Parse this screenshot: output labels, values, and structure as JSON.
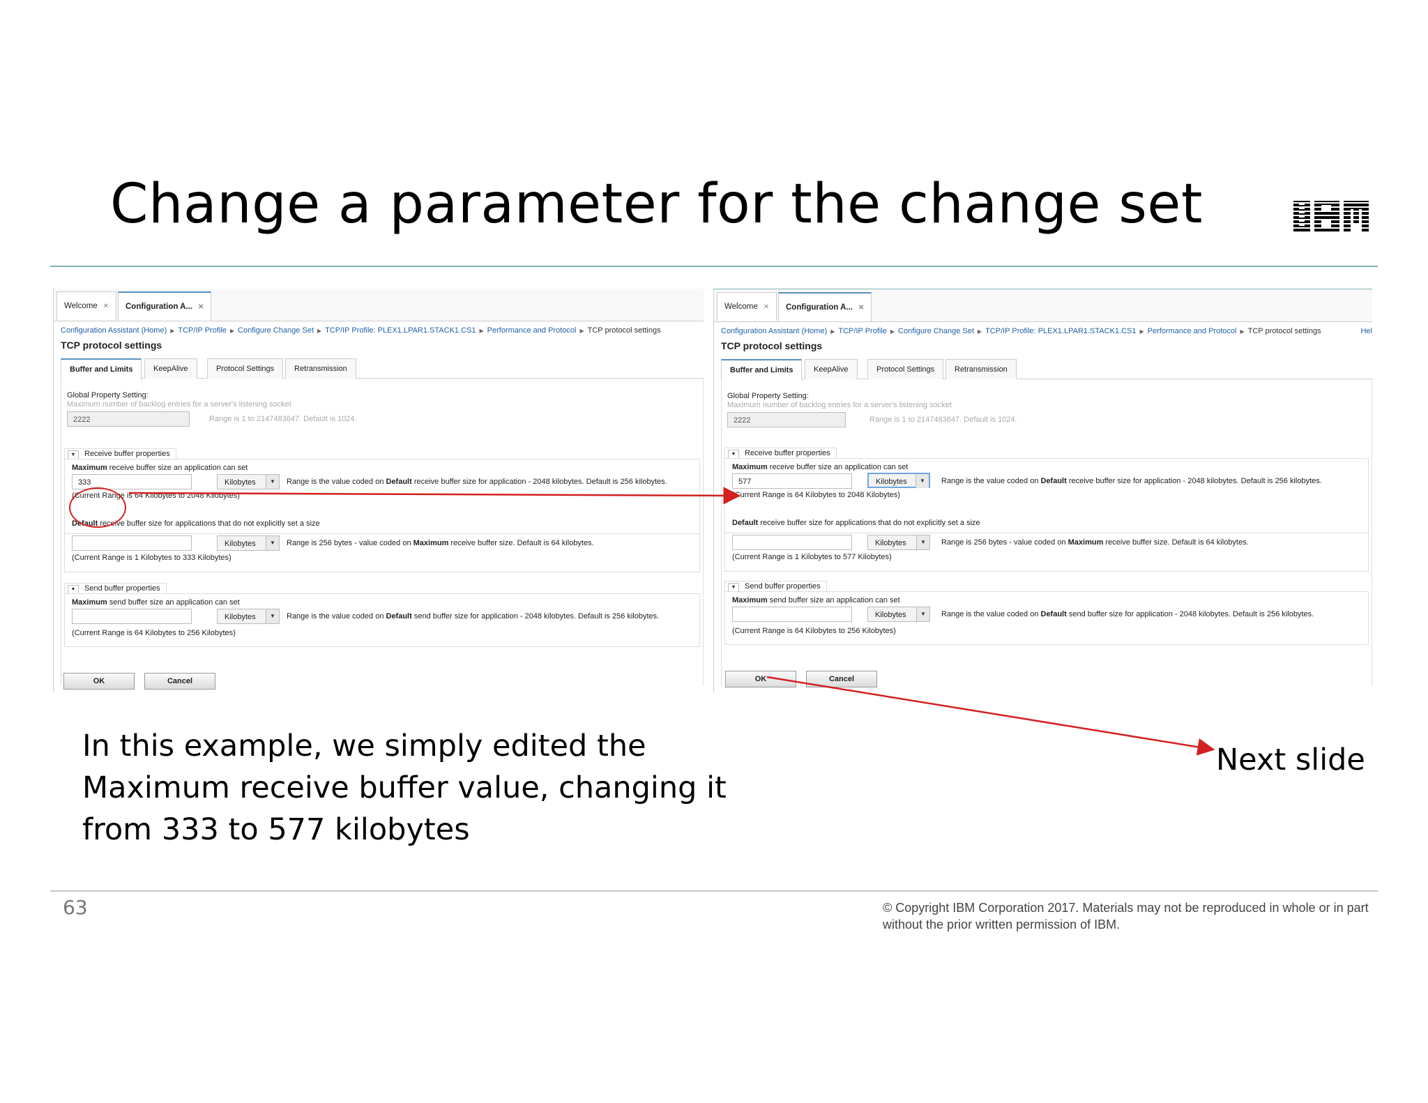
{
  "slide": {
    "title": "Change a parameter for the change set",
    "caption": "In this example, we simply edited the Maximum receive buffer value, changing it from 333 to 577 kilobytes",
    "next_label": "Next slide",
    "slide_number": "63",
    "copyright": "© Copyright IBM Corporation 2017.  Materials may not be reproduced in whole or in part without the prior written permission of IBM.",
    "logo_text": "IBM"
  },
  "app": {
    "tabs": [
      "Welcome",
      "Configuration A..."
    ],
    "breadcrumbs": [
      "Configuration Assistant (Home)",
      "TCP/IP Profile",
      "Configure Change Set",
      "TCP/IP Profile: PLEX1.LPAR1.STACK1.CS1",
      "Performance and Protocol",
      "TCP protocol settings"
    ],
    "help_label": "Hel",
    "page_title": "TCP protocol settings",
    "subtabs": [
      "Buffer and Limits",
      "KeepAlive",
      "Protocol Settings",
      "Retransmission"
    ],
    "global_label": "Global Property Setting:",
    "backlog_desc": "Maximum number of backlog entries for a server's listening socket",
    "backlog_value": "2222",
    "backlog_range": "Range is 1 to 2147483647.   Default is 1024.",
    "receive_section": "Receive buffer properties",
    "max_receive_bold": "Maximum",
    "max_receive_rest": " receive buffer size an application can set",
    "unit": "Kilobytes",
    "max_receive_range_a": "Range is the value coded on ",
    "range_bold_default": "Default",
    "max_receive_range_b": " receive buffer size for application - 2048 kilobytes.   Default is 256 kilobytes.",
    "max_receive_current": "(Current Range is 64 Kilobytes to 2048 Kilobytes)",
    "default_receive_bold": "Default",
    "default_receive_rest": " receive buffer size for applications that do not explicitly set a size",
    "default_range_a": "Range is 256 bytes - value coded on ",
    "range_bold_maximum": "Maximum",
    "default_range_b": " receive buffer size.   Default is 64 kilobytes.",
    "send_section": "Send buffer properties",
    "max_send_bold": "Maximum",
    "max_send_rest": " send buffer size an application can set",
    "send_range_a": "Range is the value coded on ",
    "send_range_b": " send buffer size for application - 2048 kilobytes.   Default is 256 kilobytes.",
    "send_current": "(Current Range is 64 Kilobytes to 256 Kilobytes)",
    "ok_label": "OK",
    "cancel_label": "Cancel"
  },
  "before": {
    "max_receive_value": "333",
    "default_current": "(Current Range is 1 Kilobytes to 333 Kilobytes)"
  },
  "after": {
    "max_receive_value": "577",
    "default_current": "(Current Range is 1 Kilobytes to 577 Kilobytes)"
  },
  "colors": {
    "accent_rule": "#7db3b3",
    "annotation_red": "#d32020",
    "link_blue": "#1f5fa8"
  }
}
